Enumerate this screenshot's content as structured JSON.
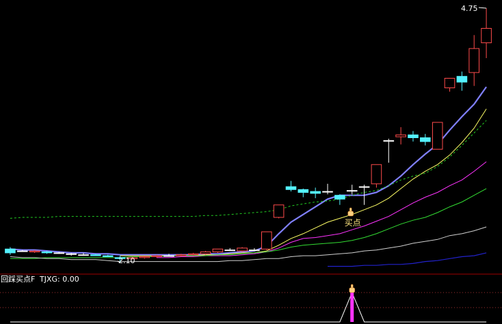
{
  "colors": {
    "up": "#ff4b4b",
    "down": "#54f2ff",
    "neutral": "#ffffff",
    "divider": "#a00000",
    "ma_thick": "#8080ff",
    "ma_yellow": "#ffff66",
    "ma_dashed": "#22cc22",
    "ma_magenta": "#ff33ff",
    "ma_green": "#33dd33",
    "ma_white": "#d0d0d0",
    "ma_blue": "#2222cc",
    "signal": "#ff33ff",
    "label": "#ffffff",
    "buy_label": "#ffe680"
  },
  "annotations": {
    "high_label": "4.75",
    "low_label": "2.10",
    "buy_point_label": "买点"
  },
  "indicator": {
    "name_label": "回踩买点F",
    "value_label": "TJXG: 0.00"
  },
  "icons": {
    "buy_marker": "pointing-hand-icon"
  },
  "chart_data": {
    "type": "candlestick",
    "price_ylim": [
      2.0,
      4.8
    ],
    "high_value": 4.75,
    "low_value": 2.1,
    "candles": [
      {
        "o": 2.24,
        "h": 2.26,
        "l": 2.18,
        "c": 2.2
      },
      {
        "o": 2.22,
        "h": 2.23,
        "l": 2.21,
        "c": 2.22
      },
      {
        "o": 2.21,
        "h": 2.23,
        "l": 2.2,
        "c": 2.22
      },
      {
        "o": 2.21,
        "h": 2.22,
        "l": 2.19,
        "c": 2.2
      },
      {
        "o": 2.2,
        "h": 2.21,
        "l": 2.19,
        "c": 2.2
      },
      {
        "o": 2.19,
        "h": 2.2,
        "l": 2.17,
        "c": 2.19
      },
      {
        "o": 2.18,
        "h": 2.2,
        "l": 2.17,
        "c": 2.18
      },
      {
        "o": 2.18,
        "h": 2.19,
        "l": 2.17,
        "c": 2.17
      },
      {
        "o": 2.17,
        "h": 2.18,
        "l": 2.16,
        "c": 2.16
      },
      {
        "o": 2.15,
        "h": 2.17,
        "l": 2.1,
        "c": 2.14
      },
      {
        "o": 2.14,
        "h": 2.16,
        "l": 2.13,
        "c": 2.15
      },
      {
        "o": 2.15,
        "h": 2.17,
        "l": 2.14,
        "c": 2.16
      },
      {
        "o": 2.16,
        "h": 2.18,
        "l": 2.15,
        "c": 2.17
      },
      {
        "o": 2.17,
        "h": 2.19,
        "l": 2.16,
        "c": 2.17
      },
      {
        "o": 2.17,
        "h": 2.19,
        "l": 2.16,
        "c": 2.18
      },
      {
        "o": 2.18,
        "h": 2.2,
        "l": 2.17,
        "c": 2.19
      },
      {
        "o": 2.19,
        "h": 2.22,
        "l": 2.18,
        "c": 2.21
      },
      {
        "o": 2.21,
        "h": 2.24,
        "l": 2.2,
        "c": 2.24
      },
      {
        "o": 2.23,
        "h": 2.25,
        "l": 2.22,
        "c": 2.23
      },
      {
        "o": 2.22,
        "h": 2.26,
        "l": 2.21,
        "c": 2.25
      },
      {
        "o": 2.23,
        "h": 2.25,
        "l": 2.22,
        "c": 2.23
      },
      {
        "o": 2.24,
        "h": 2.42,
        "l": 2.23,
        "c": 2.42
      },
      {
        "o": 2.57,
        "h": 2.7,
        "l": 2.56,
        "c": 2.7
      },
      {
        "o": 2.89,
        "h": 2.95,
        "l": 2.84,
        "c": 2.86
      },
      {
        "o": 2.86,
        "h": 2.87,
        "l": 2.78,
        "c": 2.83
      },
      {
        "o": 2.84,
        "h": 2.88,
        "l": 2.77,
        "c": 2.82
      },
      {
        "o": 2.84,
        "h": 2.92,
        "l": 2.81,
        "c": 2.84
      },
      {
        "o": 2.8,
        "h": 2.81,
        "l": 2.7,
        "c": 2.76
      },
      {
        "o": 2.85,
        "h": 2.91,
        "l": 2.81,
        "c": 2.85
      },
      {
        "o": 2.89,
        "h": 2.91,
        "l": 2.7,
        "c": 2.89
      },
      {
        "o": 2.92,
        "h": 3.12,
        "l": 2.88,
        "c": 3.12
      },
      {
        "o": 3.37,
        "h": 3.39,
        "l": 3.14,
        "c": 3.37
      },
      {
        "o": 3.41,
        "h": 3.51,
        "l": 3.33,
        "c": 3.43
      },
      {
        "o": 3.43,
        "h": 3.47,
        "l": 3.36,
        "c": 3.4
      },
      {
        "o": 3.4,
        "h": 3.44,
        "l": 3.32,
        "c": 3.36
      },
      {
        "o": 3.28,
        "h": 3.56,
        "l": 3.28,
        "c": 3.56
      },
      {
        "o": 3.92,
        "h": 4.02,
        "l": 3.88,
        "c": 4.02
      },
      {
        "o": 4.04,
        "h": 4.09,
        "l": 3.89,
        "c": 3.98
      },
      {
        "o": 4.08,
        "h": 4.47,
        "l": 3.94,
        "c": 4.33
      },
      {
        "o": 4.39,
        "h": 4.75,
        "l": 4.23,
        "c": 4.54
      }
    ],
    "ma_series": [
      {
        "key": "thick",
        "values": [
          2.24,
          2.23,
          2.23,
          2.22,
          2.21,
          2.2,
          2.2,
          2.19,
          2.19,
          2.18,
          2.18,
          2.18,
          2.18,
          2.18,
          2.18,
          2.18,
          2.19,
          2.19,
          2.2,
          2.21,
          2.22,
          2.27,
          2.4,
          2.52,
          2.6,
          2.68,
          2.76,
          2.8,
          2.8,
          2.8,
          2.83,
          2.9,
          3.0,
          3.12,
          3.23,
          3.33,
          3.48,
          3.62,
          3.75,
          3.93
        ]
      },
      {
        "key": "yellow",
        "values": [
          null,
          null,
          null,
          null,
          null,
          null,
          null,
          null,
          null,
          2.17,
          2.17,
          2.17,
          2.17,
          2.17,
          2.17,
          2.17,
          2.18,
          2.18,
          2.19,
          2.2,
          2.2,
          2.22,
          2.28,
          2.35,
          2.4,
          2.46,
          2.52,
          2.56,
          2.6,
          2.65,
          2.7,
          2.77,
          2.87,
          2.97,
          3.05,
          3.12,
          3.22,
          3.35,
          3.5,
          3.7
        ]
      },
      {
        "key": "dashed",
        "values": [
          2.56,
          2.57,
          2.57,
          2.57,
          2.58,
          2.58,
          2.58,
          2.58,
          2.58,
          2.58,
          2.58,
          2.58,
          2.58,
          2.58,
          2.58,
          2.58,
          2.59,
          2.59,
          2.6,
          2.61,
          2.62,
          2.63,
          2.65,
          2.69,
          2.71,
          2.73,
          2.74,
          2.76,
          2.8,
          2.83,
          2.85,
          2.9,
          2.96,
          3.0,
          3.03,
          3.1,
          3.2,
          3.32,
          3.45,
          3.58
        ]
      },
      {
        "key": "magenta",
        "values": [
          null,
          null,
          null,
          null,
          null,
          null,
          null,
          null,
          null,
          null,
          null,
          null,
          2.15,
          2.15,
          2.16,
          2.16,
          2.17,
          2.17,
          2.17,
          2.18,
          2.19,
          2.21,
          2.25,
          2.31,
          2.35,
          2.36,
          2.38,
          2.4,
          2.44,
          2.48,
          2.53,
          2.58,
          2.65,
          2.72,
          2.78,
          2.83,
          2.9,
          2.96,
          3.05,
          3.15
        ]
      },
      {
        "key": "green",
        "values": [
          2.14,
          2.14,
          2.14,
          2.15,
          2.15,
          2.15,
          2.15,
          2.15,
          2.15,
          2.15,
          2.16,
          2.16,
          2.16,
          2.17,
          2.17,
          2.17,
          2.17,
          2.18,
          2.18,
          2.19,
          2.2,
          2.21,
          2.23,
          2.26,
          2.28,
          2.29,
          2.3,
          2.31,
          2.33,
          2.36,
          2.4,
          2.45,
          2.5,
          2.54,
          2.57,
          2.62,
          2.68,
          2.73,
          2.8,
          2.87
        ]
      },
      {
        "key": "white",
        "values": [
          2.16,
          2.15,
          2.15,
          2.14,
          2.14,
          2.13,
          2.13,
          2.13,
          2.12,
          2.11,
          2.11,
          2.11,
          2.11,
          2.11,
          2.11,
          2.11,
          2.11,
          2.11,
          2.12,
          2.12,
          2.13,
          2.14,
          2.14,
          2.16,
          2.17,
          2.17,
          2.18,
          2.19,
          2.2,
          2.22,
          2.23,
          2.25,
          2.27,
          2.3,
          2.32,
          2.34,
          2.38,
          2.4,
          2.43,
          2.47
        ]
      },
      {
        "key": "blue",
        "values": [
          null,
          null,
          null,
          null,
          null,
          null,
          null,
          null,
          null,
          null,
          null,
          null,
          null,
          null,
          null,
          null,
          null,
          null,
          null,
          null,
          null,
          null,
          null,
          null,
          null,
          null,
          2.06,
          2.06,
          2.06,
          2.07,
          2.07,
          2.08,
          2.08,
          2.09,
          2.11,
          2.12,
          2.14,
          2.16,
          2.17,
          2.2
        ]
      }
    ],
    "indicator_series": {
      "name": "TJXG",
      "current": 0.0,
      "ylim": [
        0,
        1
      ],
      "values": [
        0,
        0,
        0,
        0,
        0,
        0,
        0,
        0,
        0,
        0,
        0,
        0,
        0,
        0,
        0,
        0,
        0,
        0,
        0,
        0,
        0,
        0,
        0,
        0,
        0,
        0,
        0,
        0,
        1,
        0,
        0,
        0,
        0,
        0,
        0,
        0,
        0,
        0,
        0,
        0
      ]
    },
    "buy_signal_index": 28,
    "high_index": 39,
    "low_index": 9
  }
}
